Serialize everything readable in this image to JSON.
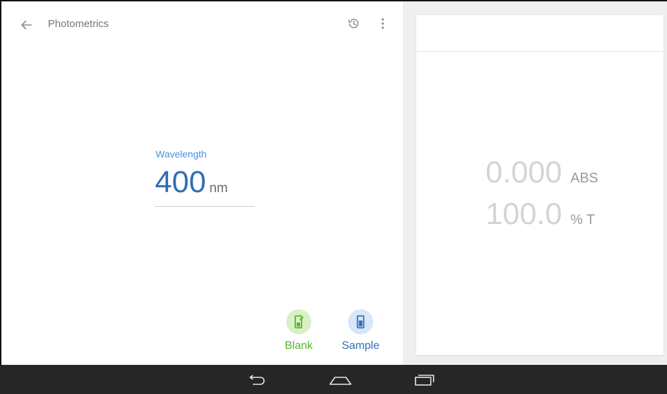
{
  "app_bar": {
    "title": "Photometrics",
    "back_icon": "arrow-back-icon",
    "history_icon": "history-icon",
    "more_icon": "more-vert-icon"
  },
  "wavelength": {
    "label": "Wavelength",
    "value": "400",
    "unit": "nm"
  },
  "actions": {
    "blank": {
      "label": "Blank",
      "icon": "cuvette-blank-icon",
      "color": "#59b32a"
    },
    "sample": {
      "label": "Sample",
      "icon": "cuvette-sample-icon",
      "color": "#2f6fb5"
    }
  },
  "results": {
    "absorbance": {
      "value": "0.000",
      "unit": "ABS"
    },
    "transmittance": {
      "value": "100.0",
      "unit": "% T"
    }
  },
  "nav_bar": {
    "back_icon": "nav-back-icon",
    "home_icon": "nav-home-icon",
    "recents_icon": "nav-recents-icon"
  },
  "colors": {
    "accent_blue": "#2f6fb5",
    "label_blue": "#4a90d9",
    "accent_green": "#59b32a",
    "nav_bar": "#262626"
  }
}
